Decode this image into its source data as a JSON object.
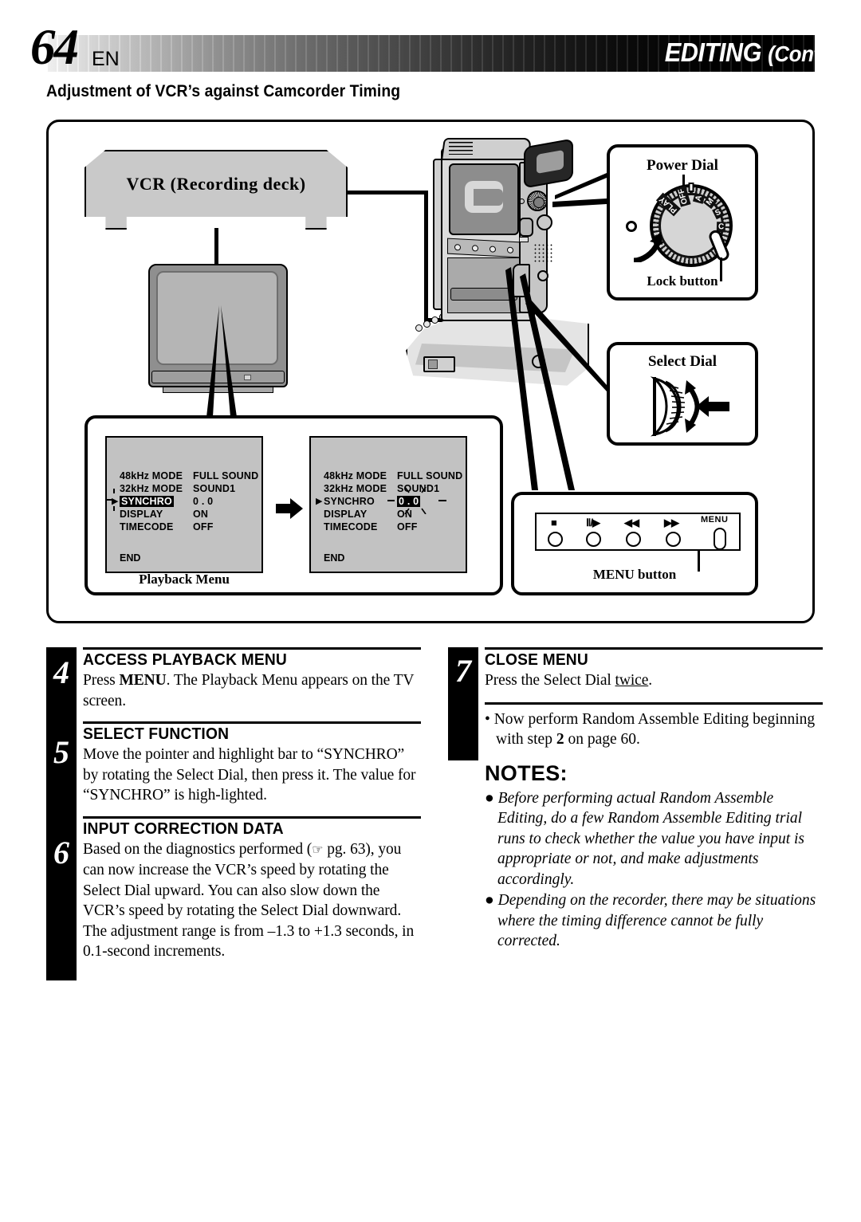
{
  "header": {
    "page_number": "64",
    "language": "EN",
    "title": "EDITING",
    "title_cont": "(Cont.)",
    "subtitle": "Adjustment of VCR’s against Camcorder Timing"
  },
  "diagram": {
    "vcr_label": "VCR (Recording deck)",
    "menus_caption": "Playback Menu",
    "screen_left": {
      "rows": [
        {
          "name": "48kHz  MODE",
          "value": "FULL SOUND",
          "pointer": false,
          "name_highlighted": false,
          "value_highlighted": false
        },
        {
          "name": "32kHz  MODE",
          "value": "SOUND1",
          "pointer": false,
          "name_highlighted": false,
          "value_highlighted": false
        },
        {
          "name": "SYNCHRO",
          "value": "0 . 0",
          "pointer": true,
          "name_highlighted": true,
          "value_highlighted": false
        },
        {
          "name": "DISPLAY",
          "value": "ON",
          "pointer": false,
          "name_highlighted": false,
          "value_highlighted": false
        },
        {
          "name": "TIMECODE",
          "value": "OFF",
          "pointer": false,
          "name_highlighted": false,
          "value_highlighted": false
        }
      ],
      "end_label": "END"
    },
    "screen_right": {
      "rows": [
        {
          "name": "48kHz  MODE",
          "value": "FULL SOUND",
          "pointer": false,
          "name_highlighted": false,
          "value_highlighted": false
        },
        {
          "name": "32kHz  MODE",
          "value": "SOUND1",
          "pointer": false,
          "name_highlighted": false,
          "value_highlighted": false
        },
        {
          "name": "SYNCHRO",
          "value": "0 . 0",
          "pointer": true,
          "name_highlighted": false,
          "value_highlighted": true
        },
        {
          "name": "DISPLAY",
          "value": "ON",
          "pointer": false,
          "name_highlighted": false,
          "value_highlighted": false
        },
        {
          "name": "TIMECODE",
          "value": "OFF",
          "pointer": false,
          "name_highlighted": false,
          "value_highlighted": false
        }
      ],
      "end_label": "END"
    },
    "power_dial": {
      "title": "Power Dial",
      "lock_label": "Lock button",
      "positions": [
        "PLAY",
        "OFF",
        "A",
        "M",
        "S",
        "C"
      ]
    },
    "select_dial": {
      "title": "Select Dial"
    },
    "button_panel": {
      "buttons": [
        "■",
        "Ⅱ/▶",
        "◀◀",
        "▶▶"
      ],
      "menu_key_label": "MENU",
      "caption": "MENU button"
    }
  },
  "steps_left": [
    {
      "number": "4",
      "title": "ACCESS PLAYBACK MENU",
      "body_before": "Press ",
      "body_bold": "MENU",
      "body_after": ". The Playback Menu appears on the TV screen."
    },
    {
      "number": "5",
      "title": "SELECT FUNCTION",
      "body": "Move the pointer and highlight bar to “SYNCHRO” by rotating the Select Dial, then press it. The value for “SYNCHRO” is high-lighted."
    },
    {
      "number": "6",
      "title": "INPUT CORRECTION DATA",
      "body_before": "Based on the diagnostics performed (",
      "body_ref": "pg. 63",
      "body_after": "), you can now increase the VCR’s speed by rotating the Select Dial upward. You can also slow down the VCR’s speed by rotating the Select Dial downward. The adjustment range is from –1.3 to +1.3 seconds, in 0.1-second increments."
    }
  ],
  "steps_right": [
    {
      "number": "7",
      "title": "CLOSE MENU",
      "body_before": "Press the Select Dial ",
      "body_underline": "twice",
      "body_after": "."
    }
  ],
  "right_bullet": {
    "before": "• Now perform Random Assemble Editing beginning with step ",
    "bold": "2",
    "after": " on page 60."
  },
  "notes": {
    "heading": "NOTES:",
    "items": [
      "● Before performing actual Random Assemble Editing, do a few Random Assemble Editing trial runs to check whether the value you have input is appropriate or not, and make adjustments accordingly.",
      "● Depending on the recorder, there may be situations where the timing difference cannot be fully corrected."
    ]
  }
}
